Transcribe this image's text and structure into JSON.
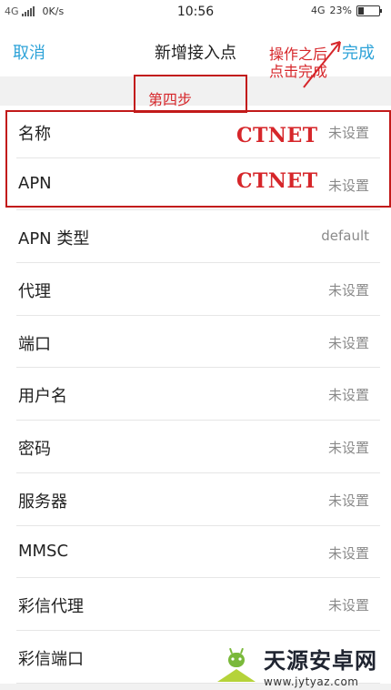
{
  "status_bar": {
    "network_type": "4G",
    "speed": "0K/s",
    "time": "10:56",
    "network_type_right": "4G",
    "battery": "23%",
    "battery_level": 0.23
  },
  "header": {
    "cancel": "取消",
    "title": "新增接入点",
    "done": "完成"
  },
  "annotations": {
    "done_hint": "操作之后点击完成",
    "step": "第四步",
    "name_value": "CTNET",
    "apn_value": "CTNET",
    "color": "#d6262a"
  },
  "fields": [
    {
      "label": "名称",
      "value": "未设置"
    },
    {
      "label": "APN",
      "value": "未设置"
    },
    {
      "label": "APN 类型",
      "value": "default"
    },
    {
      "label": "代理",
      "value": "未设置"
    },
    {
      "label": "端口",
      "value": "未设置"
    },
    {
      "label": "用户名",
      "value": "未设置"
    },
    {
      "label": "密码",
      "value": "未设置"
    },
    {
      "label": "服务器",
      "value": "未设置"
    },
    {
      "label": "MMSC",
      "value": "未设置"
    },
    {
      "label": "彩信代理",
      "value": "未设置"
    },
    {
      "label": "彩信端口",
      "value": ""
    }
  ],
  "watermark": {
    "title": "天源安卓网",
    "url": "www.jytyaz.com"
  },
  "colors": {
    "accent": "#2ea3d8",
    "annotation": "#d6262a"
  }
}
